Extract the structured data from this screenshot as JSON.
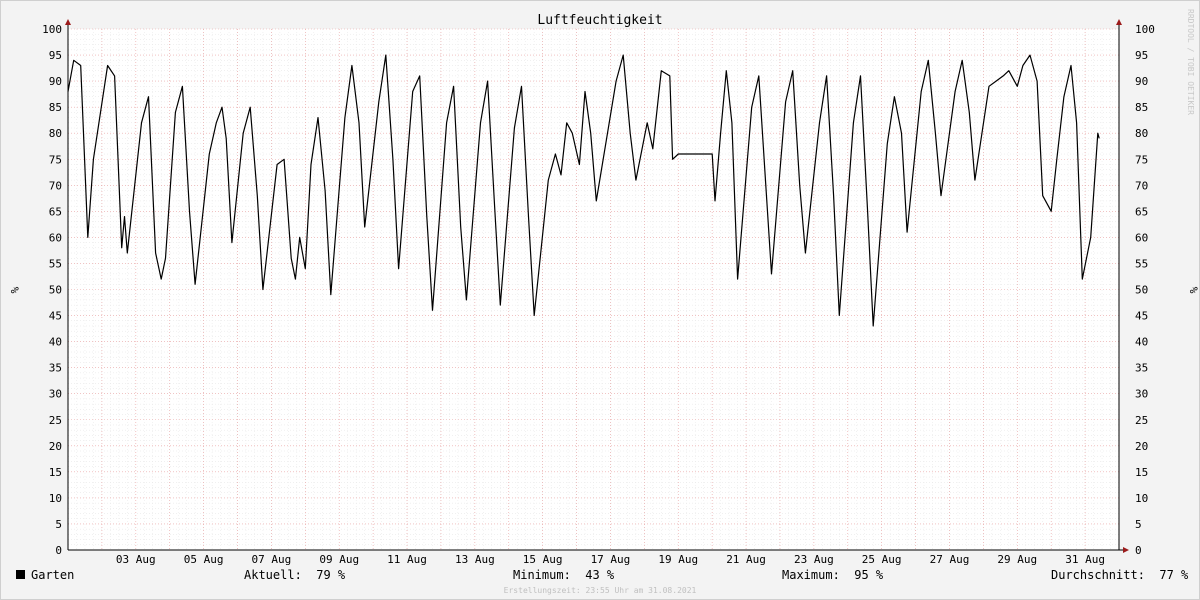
{
  "chart_data": {
    "type": "line",
    "title": "Luftfeuchtigkeit",
    "ylabel": "%",
    "y2label": "%",
    "ylim": [
      0,
      100
    ],
    "yticks": [
      0,
      5,
      10,
      15,
      20,
      25,
      30,
      35,
      40,
      45,
      50,
      55,
      60,
      65,
      70,
      75,
      80,
      85,
      90,
      95,
      100
    ],
    "xlim": [
      "2021-08-01T00:00",
      "2021-09-01T00:00"
    ],
    "xtick_labels": [
      {
        "x": "2021-08-03",
        "label": "03 Aug"
      },
      {
        "x": "2021-08-05",
        "label": "05 Aug"
      },
      {
        "x": "2021-08-07",
        "label": "07 Aug"
      },
      {
        "x": "2021-08-09",
        "label": "09 Aug"
      },
      {
        "x": "2021-08-11",
        "label": "11 Aug"
      },
      {
        "x": "2021-08-13",
        "label": "13 Aug"
      },
      {
        "x": "2021-08-15",
        "label": "15 Aug"
      },
      {
        "x": "2021-08-17",
        "label": "17 Aug"
      },
      {
        "x": "2021-08-19",
        "label": "19 Aug"
      },
      {
        "x": "2021-08-21",
        "label": "21 Aug"
      },
      {
        "x": "2021-08-23",
        "label": "23 Aug"
      },
      {
        "x": "2021-08-25",
        "label": "25 Aug"
      },
      {
        "x": "2021-08-27",
        "label": "27 Aug"
      },
      {
        "x": "2021-08-29",
        "label": "29 Aug"
      },
      {
        "x": "2021-08-31",
        "label": "31 Aug"
      }
    ],
    "grid": true,
    "series": [
      {
        "name": "Garten",
        "color": "#000000",
        "points": [
          [
            "2021-08-01T00:00",
            88
          ],
          [
            "2021-08-01T04:00",
            94
          ],
          [
            "2021-08-01T09:00",
            93
          ],
          [
            "2021-08-01T14:00",
            60
          ],
          [
            "2021-08-01T18:00",
            75
          ],
          [
            "2021-08-02T04:00",
            93
          ],
          [
            "2021-08-02T09:00",
            91
          ],
          [
            "2021-08-02T14:00",
            58
          ],
          [
            "2021-08-02T16:00",
            64
          ],
          [
            "2021-08-02T18:00",
            57
          ],
          [
            "2021-08-03T04:00",
            82
          ],
          [
            "2021-08-03T09:00",
            87
          ],
          [
            "2021-08-03T14:00",
            57
          ],
          [
            "2021-08-03T18:00",
            52
          ],
          [
            "2021-08-03T21:00",
            56
          ],
          [
            "2021-08-04T04:00",
            84
          ],
          [
            "2021-08-04T09:00",
            89
          ],
          [
            "2021-08-04T14:00",
            65
          ],
          [
            "2021-08-04T18:00",
            51
          ],
          [
            "2021-08-05T04:00",
            76
          ],
          [
            "2021-08-05T09:00",
            82
          ],
          [
            "2021-08-05T13:00",
            85
          ],
          [
            "2021-08-05T16:00",
            79
          ],
          [
            "2021-08-05T20:00",
            59
          ],
          [
            "2021-08-06T04:00",
            80
          ],
          [
            "2021-08-06T09:00",
            85
          ],
          [
            "2021-08-06T14:00",
            68
          ],
          [
            "2021-08-06T18:00",
            50
          ],
          [
            "2021-08-07T04:00",
            74
          ],
          [
            "2021-08-07T09:00",
            75
          ],
          [
            "2021-08-07T14:00",
            56
          ],
          [
            "2021-08-07T17:00",
            52
          ],
          [
            "2021-08-07T20:00",
            60
          ],
          [
            "2021-08-08T00:00",
            54
          ],
          [
            "2021-08-08T04:00",
            74
          ],
          [
            "2021-08-08T09:00",
            83
          ],
          [
            "2021-08-08T14:00",
            69
          ],
          [
            "2021-08-08T18:00",
            49
          ],
          [
            "2021-08-09T04:00",
            83
          ],
          [
            "2021-08-09T09:00",
            93
          ],
          [
            "2021-08-09T14:00",
            82
          ],
          [
            "2021-08-09T18:00",
            62
          ],
          [
            "2021-08-10T04:00",
            86
          ],
          [
            "2021-08-10T09:00",
            95
          ],
          [
            "2021-08-10T14:00",
            75
          ],
          [
            "2021-08-10T18:00",
            54
          ],
          [
            "2021-08-11T04:00",
            88
          ],
          [
            "2021-08-11T09:00",
            91
          ],
          [
            "2021-08-11T14:00",
            64
          ],
          [
            "2021-08-11T18:00",
            46
          ],
          [
            "2021-08-12T04:00",
            82
          ],
          [
            "2021-08-12T09:00",
            89
          ],
          [
            "2021-08-12T14:00",
            62
          ],
          [
            "2021-08-12T18:00",
            48
          ],
          [
            "2021-08-13T04:00",
            82
          ],
          [
            "2021-08-13T09:00",
            90
          ],
          [
            "2021-08-13T14:00",
            66
          ],
          [
            "2021-08-13T18:00",
            47
          ],
          [
            "2021-08-14T04:00",
            81
          ],
          [
            "2021-08-14T09:00",
            89
          ],
          [
            "2021-08-14T14:00",
            64
          ],
          [
            "2021-08-14T18:00",
            45
          ],
          [
            "2021-08-15T04:00",
            71
          ],
          [
            "2021-08-15T09:00",
            76
          ],
          [
            "2021-08-15T13:00",
            72
          ],
          [
            "2021-08-15T17:00",
            82
          ],
          [
            "2021-08-15T21:00",
            80
          ],
          [
            "2021-08-16T02:00",
            74
          ],
          [
            "2021-08-16T06:00",
            88
          ],
          [
            "2021-08-16T10:00",
            80
          ],
          [
            "2021-08-16T14:00",
            67
          ],
          [
            "2021-08-17T04:00",
            90
          ],
          [
            "2021-08-17T09:00",
            95
          ],
          [
            "2021-08-17T14:00",
            80
          ],
          [
            "2021-08-17T18:00",
            71
          ],
          [
            "2021-08-18T02:00",
            82
          ],
          [
            "2021-08-18T06:00",
            77
          ],
          [
            "2021-08-18T12:00",
            92
          ],
          [
            "2021-08-18T18:00",
            91
          ],
          [
            "2021-08-18T20:00",
            75
          ],
          [
            "2021-08-19T00:00",
            76
          ],
          [
            "2021-08-20T00:00",
            76
          ],
          [
            "2021-08-20T02:00",
            67
          ],
          [
            "2021-08-20T06:00",
            80
          ],
          [
            "2021-08-20T10:00",
            92
          ],
          [
            "2021-08-20T14:00",
            82
          ],
          [
            "2021-08-20T18:00",
            52
          ],
          [
            "2021-08-21T04:00",
            85
          ],
          [
            "2021-08-21T09:00",
            91
          ],
          [
            "2021-08-21T14:00",
            70
          ],
          [
            "2021-08-21T18:00",
            53
          ],
          [
            "2021-08-22T04:00",
            86
          ],
          [
            "2021-08-22T09:00",
            92
          ],
          [
            "2021-08-22T14:00",
            70
          ],
          [
            "2021-08-22T18:00",
            57
          ],
          [
            "2021-08-23T04:00",
            82
          ],
          [
            "2021-08-23T09:00",
            91
          ],
          [
            "2021-08-23T14:00",
            68
          ],
          [
            "2021-08-23T18:00",
            45
          ],
          [
            "2021-08-24T04:00",
            82
          ],
          [
            "2021-08-24T09:00",
            91
          ],
          [
            "2021-08-24T14:00",
            65
          ],
          [
            "2021-08-24T18:00",
            43
          ],
          [
            "2021-08-25T04:00",
            78
          ],
          [
            "2021-08-25T09:00",
            87
          ],
          [
            "2021-08-25T14:00",
            80
          ],
          [
            "2021-08-25T18:00",
            61
          ],
          [
            "2021-08-26T04:00",
            88
          ],
          [
            "2021-08-26T09:00",
            94
          ],
          [
            "2021-08-26T14:00",
            80
          ],
          [
            "2021-08-26T18:00",
            68
          ],
          [
            "2021-08-27T04:00",
            88
          ],
          [
            "2021-08-27T09:00",
            94
          ],
          [
            "2021-08-27T14:00",
            84
          ],
          [
            "2021-08-27T18:00",
            71
          ],
          [
            "2021-08-28T04:00",
            89
          ],
          [
            "2021-08-28T09:00",
            90
          ],
          [
            "2021-08-28T14:00",
            91
          ],
          [
            "2021-08-28T18:00",
            92
          ],
          [
            "2021-08-29T00:00",
            89
          ],
          [
            "2021-08-29T04:00",
            93
          ],
          [
            "2021-08-29T09:00",
            95
          ],
          [
            "2021-08-29T14:00",
            90
          ],
          [
            "2021-08-29T18:00",
            68
          ],
          [
            "2021-08-30T00:00",
            65
          ],
          [
            "2021-08-30T04:00",
            75
          ],
          [
            "2021-08-30T09:00",
            87
          ],
          [
            "2021-08-30T14:00",
            93
          ],
          [
            "2021-08-30T18:00",
            82
          ],
          [
            "2021-08-30T22:00",
            52
          ],
          [
            "2021-08-31T04:00",
            60
          ],
          [
            "2021-08-31T09:00",
            80
          ],
          [
            "2021-08-31T10:00",
            79
          ]
        ]
      }
    ]
  },
  "watermark": "RRDTOOL / TOBI OETIKER",
  "legend": {
    "series_name": "Garten",
    "current": "Aktuell:  79 %",
    "minimum": "Minimum:  43 %",
    "maximum": "Maximum:  95 %",
    "average": "Durchschnitt:  77 %"
  },
  "footer": "Erstellungszeit: 23:55 Uhr am 31.08.2021"
}
